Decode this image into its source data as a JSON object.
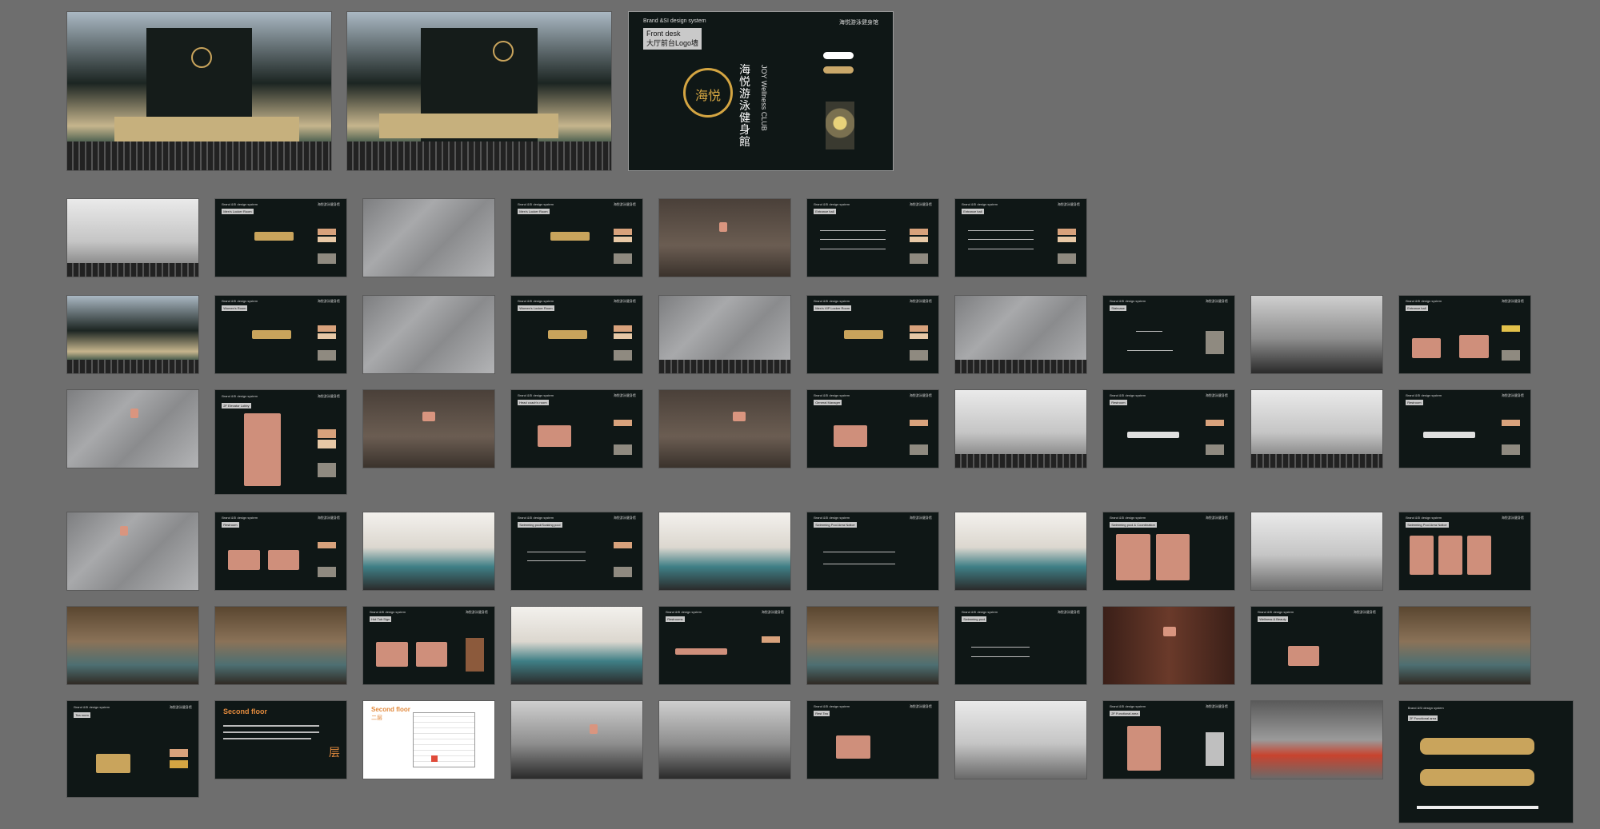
{
  "main_board": {
    "header_left": "Brand &SI design system",
    "header_right": "海悦游泳健身馆",
    "label_en": "Front desk",
    "label_cn": "大厅前台Logo墙",
    "logo_char": "海悦",
    "brand_cn": "海悦游泳健身館",
    "brand_en": "JOY Wellness CLUB"
  },
  "second_floor": {
    "title_en": "Second floor",
    "title_cn": "二层",
    "char": "层"
  },
  "board_header_left": "Brand &SI design system",
  "board_header_right": "海悦游泳健身馆",
  "labels": [
    "Men's Locker Room",
    "Women's Room",
    "Women's Locker Room",
    "Men's VIP Locker Room",
    "Entrance hall",
    "Entrance hall",
    "Staircase",
    "Entrance hall",
    "2F Elevator Lobby",
    "Head coach's room",
    "General Manager",
    "Restroom",
    "Restroom",
    "Restroom",
    "Swimming pool/Soaking pool",
    "Swimming Pool Area Notice",
    "Swimming pool & Coordination",
    "Swimming Pool Area Notice",
    "Hot Tub Sign",
    "Restrooms",
    "Swimming pool",
    "Wellness & Beauty",
    "Tea room",
    "Rest Tea",
    "2F Functional area",
    "2F Functional area"
  ]
}
